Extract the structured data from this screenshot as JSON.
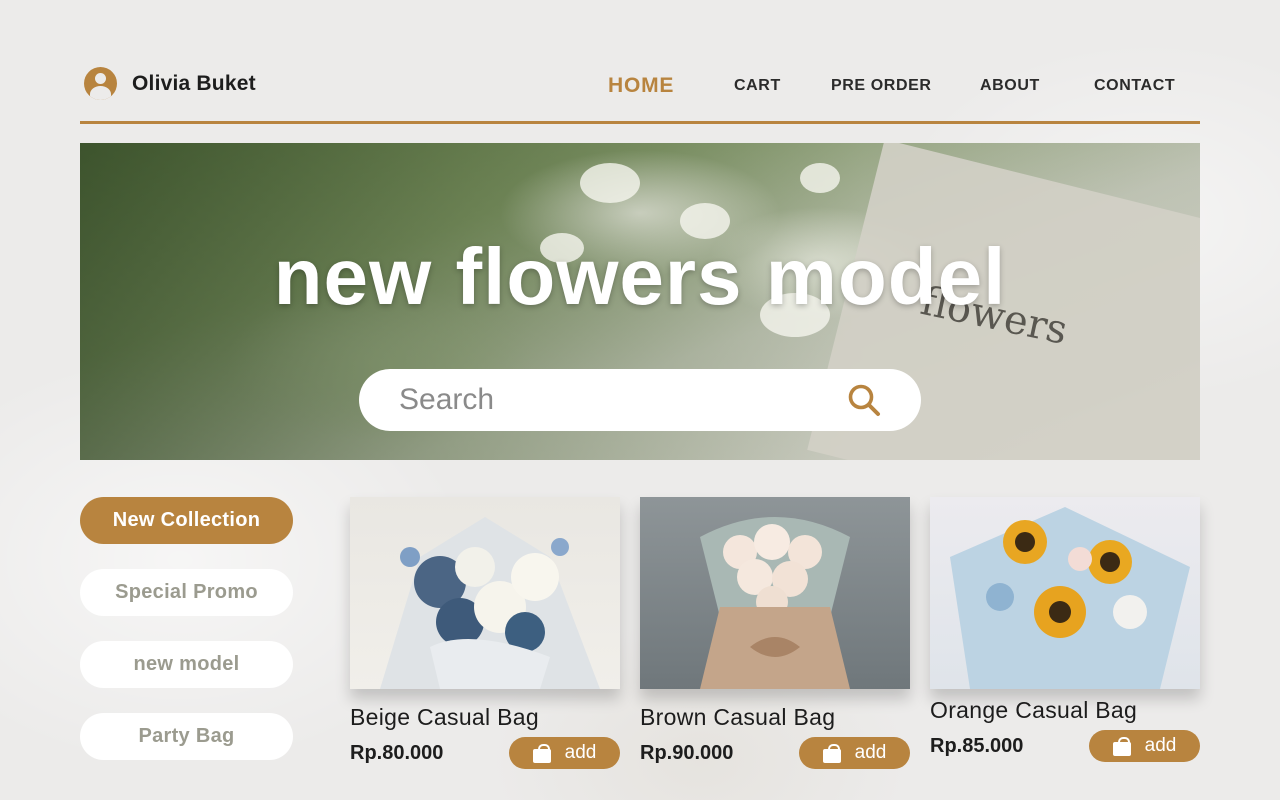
{
  "brand": {
    "name": "Olivia Buket",
    "icon": "user-circle-icon"
  },
  "nav": {
    "items": [
      {
        "label": "HOME",
        "active": true
      },
      {
        "label": "CART",
        "active": false
      },
      {
        "label": "PRE ORDER",
        "active": false
      },
      {
        "label": "ABOUT",
        "active": false
      },
      {
        "label": "CONTACT",
        "active": false
      }
    ]
  },
  "hero": {
    "title": "new flowers model",
    "card_text": "flowers",
    "search": {
      "placeholder": "Search",
      "icon": "search-icon"
    }
  },
  "categories": [
    {
      "label": "New Collection",
      "active": true
    },
    {
      "label": "Special Promo",
      "active": false
    },
    {
      "label": "new model",
      "active": false
    },
    {
      "label": "Party Bag",
      "active": false
    }
  ],
  "products": [
    {
      "name": "Beige Casual Bag",
      "price": "Rp.80.000",
      "button": "add"
    },
    {
      "name": "Brown Casual Bag",
      "price": "Rp.90.000",
      "button": "add"
    },
    {
      "name": "Orange Casual Bag",
      "price": "Rp.85.000",
      "button": "add"
    }
  ],
  "colors": {
    "accent": "#b8843f",
    "background": "#ecebea",
    "text": "#1d1d1d"
  }
}
